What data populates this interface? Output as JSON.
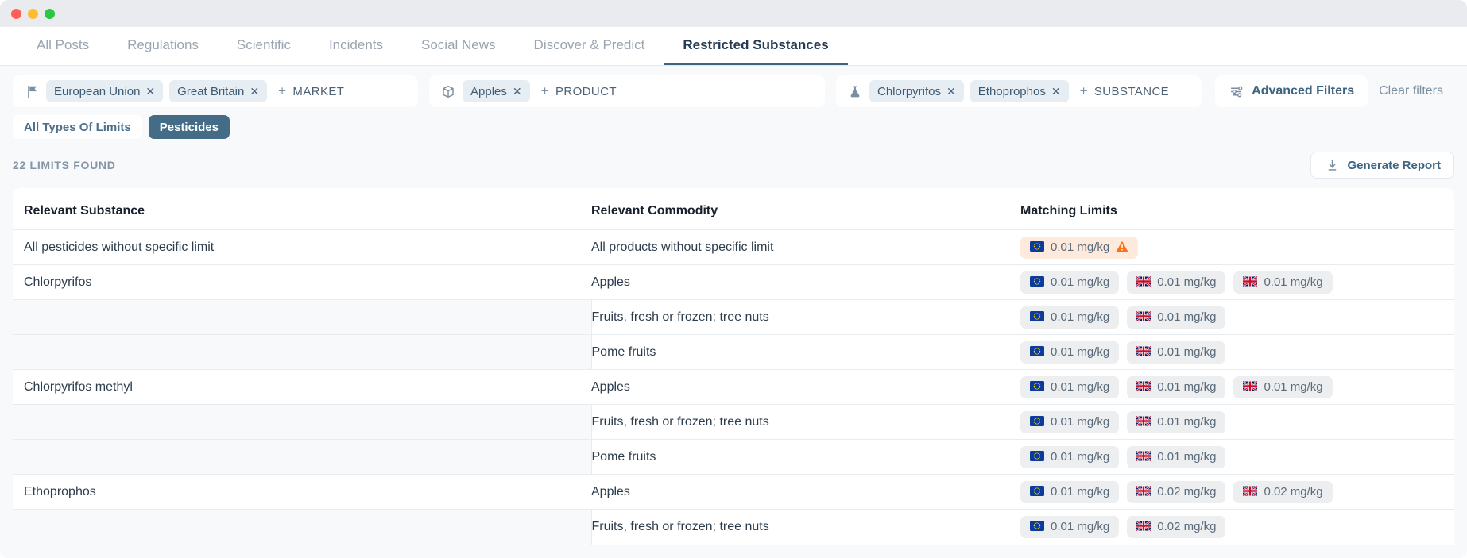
{
  "window": {
    "traffic_lights": [
      "close",
      "minimize",
      "maximize"
    ]
  },
  "tabs": [
    {
      "label": "All Posts",
      "active": false
    },
    {
      "label": "Regulations",
      "active": false
    },
    {
      "label": "Scientific",
      "active": false
    },
    {
      "label": "Incidents",
      "active": false
    },
    {
      "label": "Social News",
      "active": false
    },
    {
      "label": "Discover & Predict",
      "active": false
    },
    {
      "label": "Restricted Substances",
      "active": true
    }
  ],
  "filters": {
    "market": {
      "icon": "flag-icon",
      "chips": [
        "European Union",
        "Great Britain"
      ],
      "add_label": "MARKET",
      "add_plus": "+"
    },
    "product": {
      "icon": "box-icon",
      "chips": [
        "Apples"
      ],
      "add_label": "PRODUCT",
      "add_plus": "+"
    },
    "substance": {
      "icon": "flask-icon",
      "chips": [
        "Chlorpyrifos",
        "Ethoprophos"
      ],
      "add_label": "SUBSTANCE",
      "add_plus": "+"
    },
    "advanced_filters_label": "Advanced Filters",
    "clear_filters_label": "Clear filters",
    "chip_remove_glyph": "✕"
  },
  "limit_types": [
    {
      "label": "All Types Of Limits",
      "selected": false
    },
    {
      "label": "Pesticides",
      "selected": true
    }
  ],
  "results": {
    "count_label": "22 LIMITS FOUND",
    "generate_report_label": "Generate Report"
  },
  "table": {
    "headers": [
      "Relevant Substance",
      "Relevant Commodity",
      "Matching Limits"
    ],
    "rows": [
      {
        "substance": "All pesticides without specific limit",
        "commodity": "All products without specific limit",
        "limits": [
          {
            "flag": "eu",
            "value": "0.01 mg/kg",
            "warning": true
          }
        ]
      },
      {
        "substance": "Chlorpyrifos",
        "commodity": "Apples",
        "limits": [
          {
            "flag": "eu",
            "value": "0.01 mg/kg",
            "warning": false
          },
          {
            "flag": "gb",
            "value": "0.01 mg/kg",
            "warning": false
          },
          {
            "flag": "gb",
            "value": "0.01 mg/kg",
            "warning": false
          }
        ]
      },
      {
        "substance": "",
        "commodity": "Fruits, fresh or frozen; tree nuts",
        "limits": [
          {
            "flag": "eu",
            "value": "0.01 mg/kg",
            "warning": false
          },
          {
            "flag": "gb",
            "value": "0.01 mg/kg",
            "warning": false
          }
        ]
      },
      {
        "substance": "",
        "commodity": "Pome fruits",
        "limits": [
          {
            "flag": "eu",
            "value": "0.01 mg/kg",
            "warning": false
          },
          {
            "flag": "gb",
            "value": "0.01 mg/kg",
            "warning": false
          }
        ]
      },
      {
        "substance": "Chlorpyrifos methyl",
        "commodity": "Apples",
        "limits": [
          {
            "flag": "eu",
            "value": "0.01 mg/kg",
            "warning": false
          },
          {
            "flag": "gb",
            "value": "0.01 mg/kg",
            "warning": false
          },
          {
            "flag": "gb",
            "value": "0.01 mg/kg",
            "warning": false
          }
        ]
      },
      {
        "substance": "",
        "commodity": "Fruits, fresh or frozen; tree nuts",
        "limits": [
          {
            "flag": "eu",
            "value": "0.01 mg/kg",
            "warning": false
          },
          {
            "flag": "gb",
            "value": "0.01 mg/kg",
            "warning": false
          }
        ]
      },
      {
        "substance": "",
        "commodity": "Pome fruits",
        "limits": [
          {
            "flag": "eu",
            "value": "0.01 mg/kg",
            "warning": false
          },
          {
            "flag": "gb",
            "value": "0.01 mg/kg",
            "warning": false
          }
        ]
      },
      {
        "substance": "Ethoprophos",
        "commodity": "Apples",
        "limits": [
          {
            "flag": "eu",
            "value": "0.01 mg/kg",
            "warning": false
          },
          {
            "flag": "gb",
            "value": "0.02 mg/kg",
            "warning": false
          },
          {
            "flag": "gb",
            "value": "0.02 mg/kg",
            "warning": false
          }
        ]
      },
      {
        "substance": "",
        "commodity": "Fruits, fresh or frozen; tree nuts",
        "limits": [
          {
            "flag": "eu",
            "value": "0.01 mg/kg",
            "warning": false
          },
          {
            "flag": "gb",
            "value": "0.02 mg/kg",
            "warning": false
          }
        ]
      }
    ]
  },
  "glyphs": {
    "flag_eu": "🇪🇺",
    "flag_gb": "🇬🇧",
    "warning": "⚠"
  },
  "colors": {
    "accent": "#3d6480",
    "toggle_on_bg": "#456c87",
    "chip_bg": "#e6edf3",
    "limit_chip_bg": "#eceef0",
    "warn_chip_bg": "#fdeadd",
    "warn_icon": "#f97316",
    "page_bg": "#f7f9fb"
  }
}
